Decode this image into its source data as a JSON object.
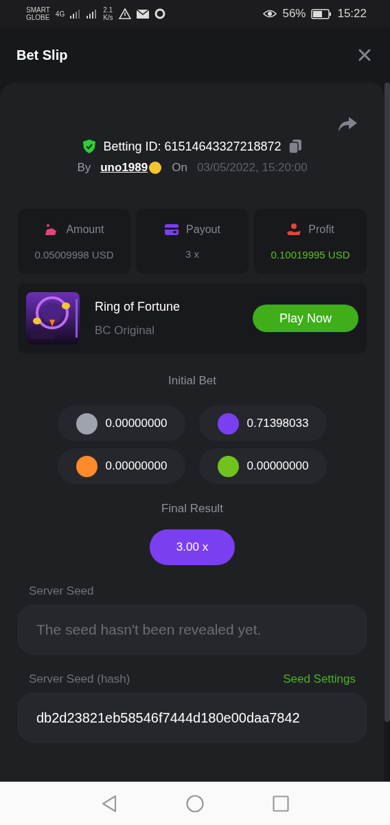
{
  "status_bar": {
    "carrier_line1": "SMART",
    "carrier_line2": "GLOBE",
    "network": "4G",
    "speed_value": "2.1",
    "speed_unit": "K/s",
    "battery": "56%",
    "time": "15:22"
  },
  "header": {
    "title": "Bet Slip"
  },
  "bet": {
    "id_label": "Betting ID: 61514643327218872",
    "by_label": "By",
    "user": "uno1989",
    "on_label": "On",
    "date": "03/05/2022, 15:20:00"
  },
  "stats": [
    {
      "kind": "amount",
      "label": "Amount",
      "value": "0.05009998 USD",
      "positive": false
    },
    {
      "kind": "payout",
      "label": "Payout",
      "value": "3 x",
      "positive": false
    },
    {
      "kind": "profit",
      "label": "Profit",
      "value": "0.10019995 USD",
      "positive": true
    }
  ],
  "game": {
    "name": "Ring of Fortune",
    "subtitle": "BC Original",
    "button": "Play Now"
  },
  "initial_bet": {
    "title": "Initial Bet",
    "chips": [
      {
        "color": "#9ea3ad",
        "value": "0.00000000"
      },
      {
        "color": "#7b3ff2",
        "value": "0.71398033"
      },
      {
        "color": "#ff8a2a",
        "value": "0.00000000"
      },
      {
        "color": "#72c21e",
        "value": "0.00000000"
      }
    ]
  },
  "final_result": {
    "title": "Final Result",
    "value": "3.00 x"
  },
  "server_seed": {
    "label": "Server Seed",
    "placeholder": "The seed hasn't been revealed yet."
  },
  "server_seed_hash": {
    "label": "Server Seed (hash)",
    "link": "Seed Settings",
    "value": "db2d23821eb58546f7444d180e00daa7842"
  }
}
